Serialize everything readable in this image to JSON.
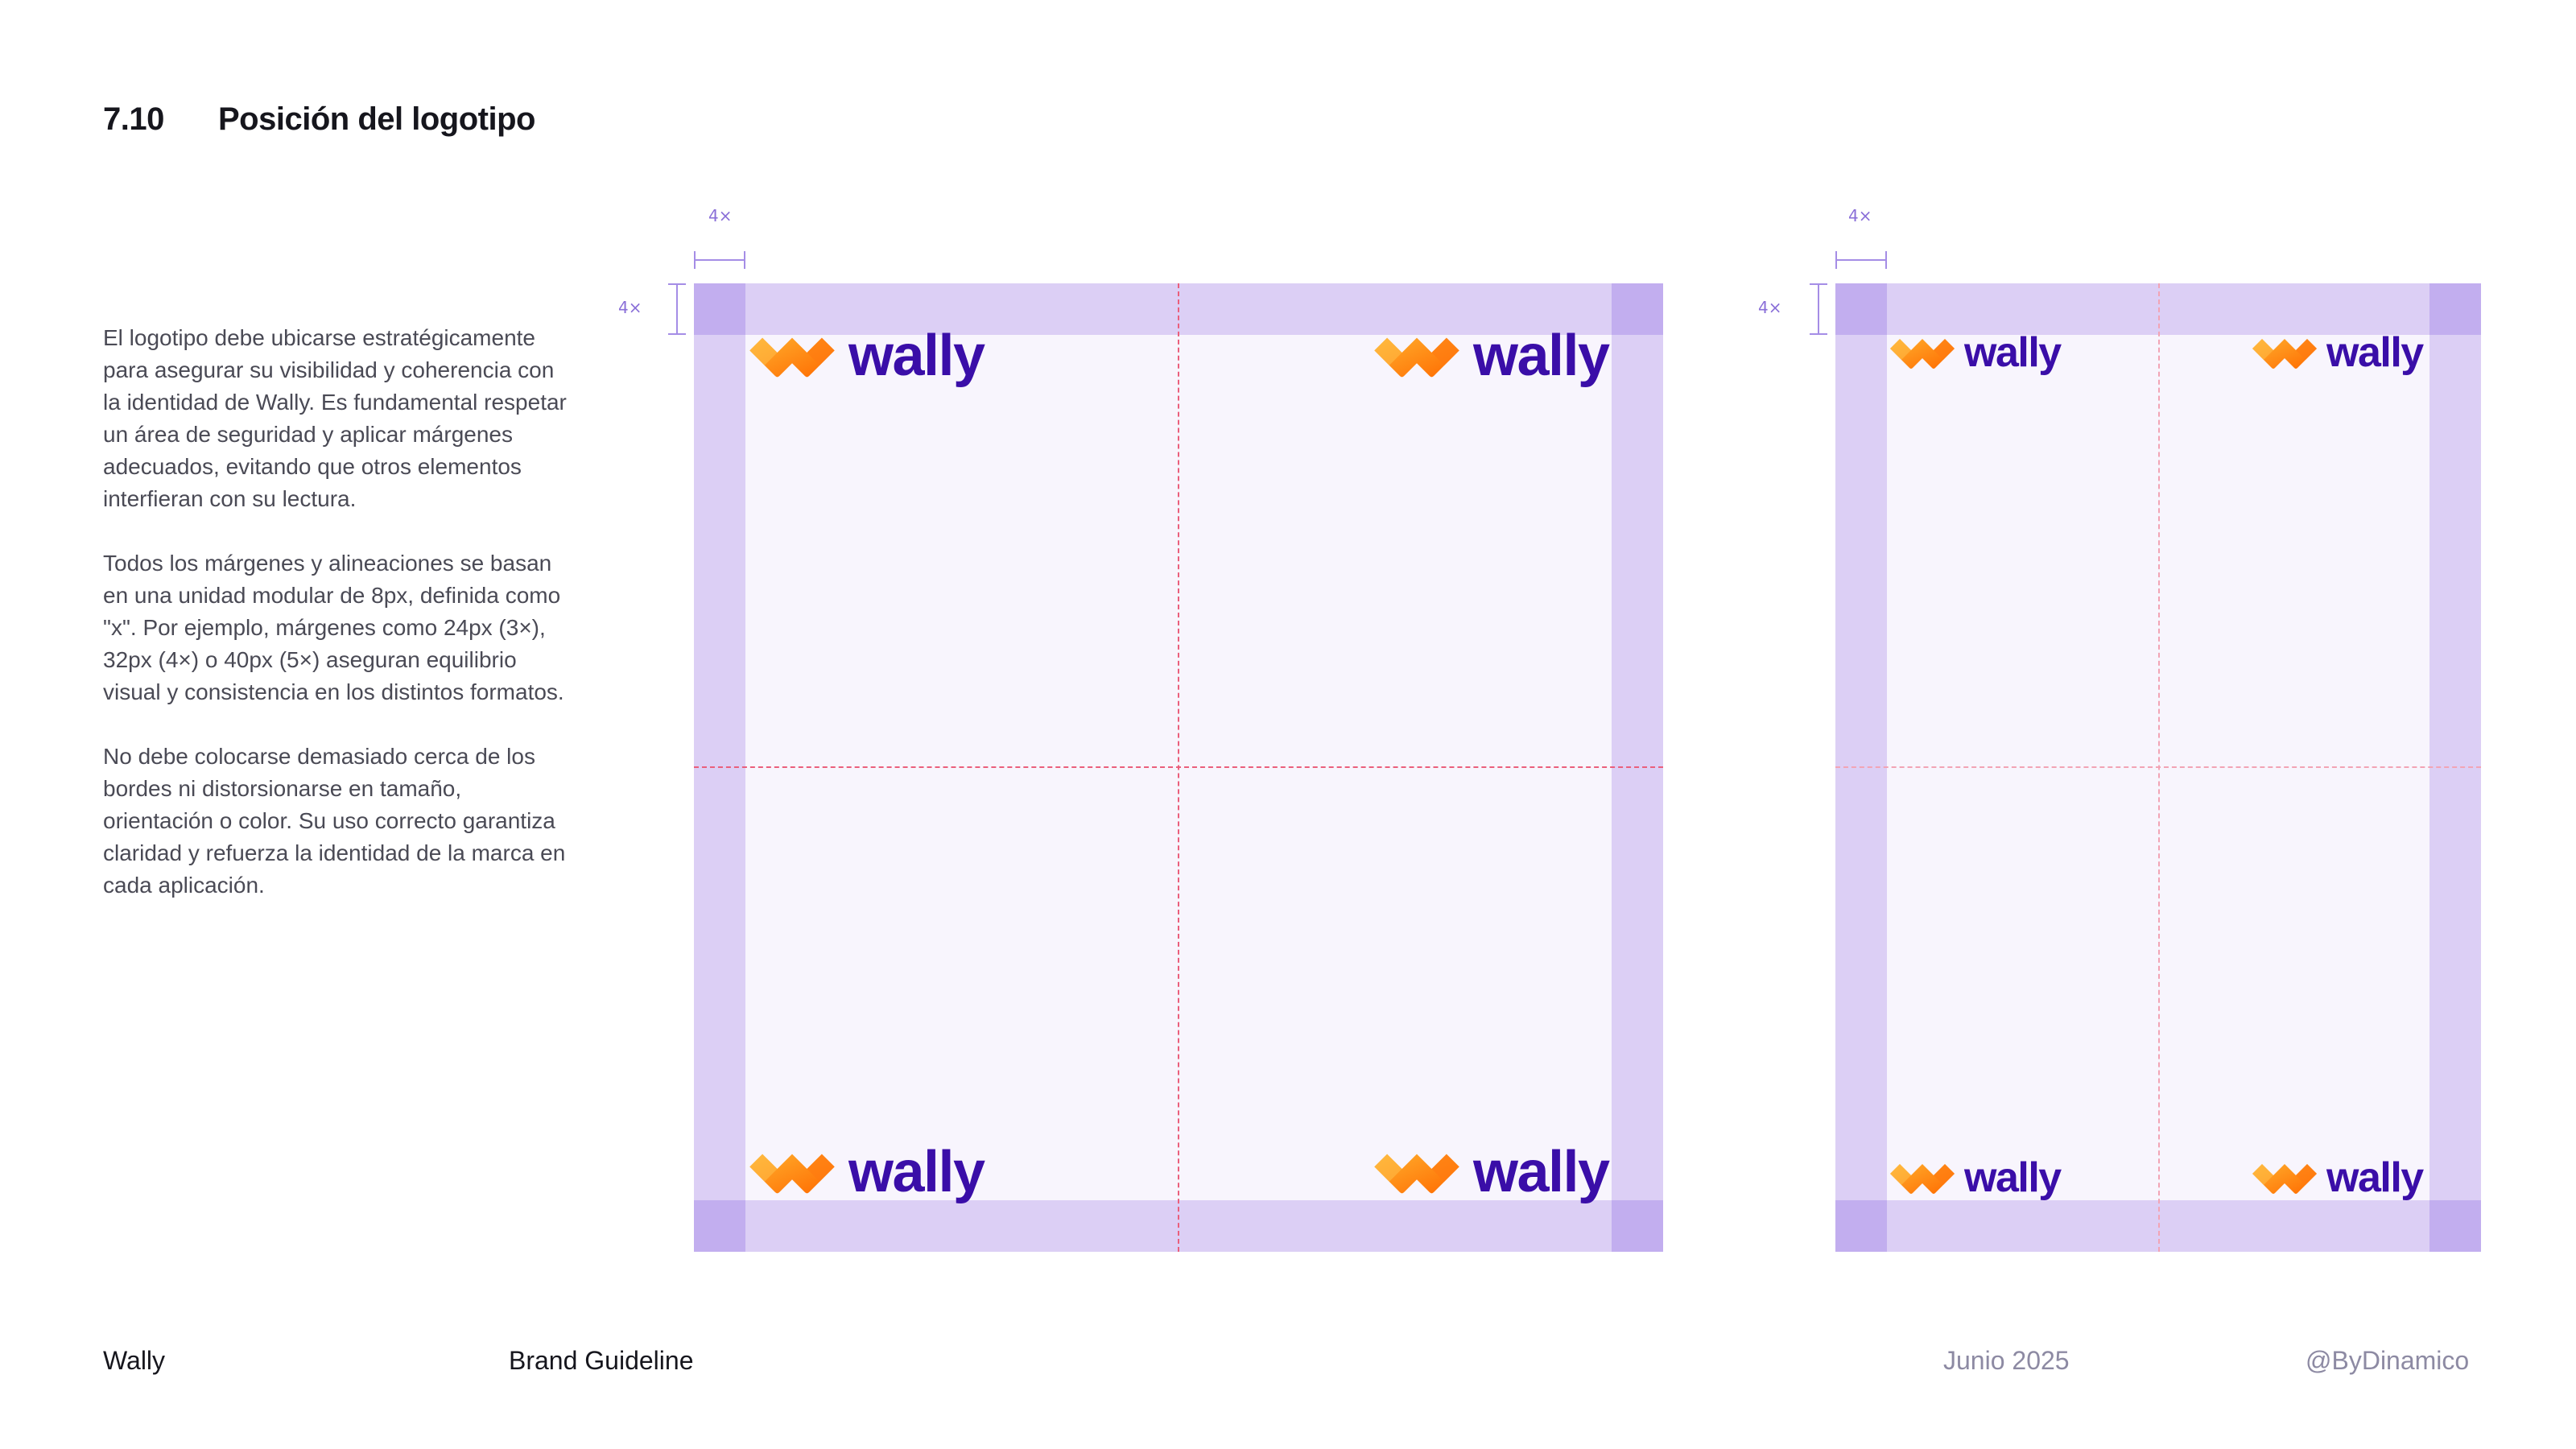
{
  "header": {
    "section_number": "7.10",
    "section_title": "Posición del logotipo"
  },
  "body": {
    "paragraphs": [
      "El logotipo debe ubicarse estratégicamente para asegurar su visibilidad y coherencia con la identidad de Wally. Es fundamental respetar un área de seguridad y aplicar márgenes adecuados, evitando que otros elementos interfieran con su lectura.",
      "Todos los márgenes y alineaciones se basan en una unidad modular de 8px, definida como \"x\". Por ejemplo, márgenes como 24px (3×), 32px (4×) o 40px (5×) aseguran equilibrio visual y consistencia en los distintos formatos.",
      "No debe colocarse demasiado cerca de los bordes ni distorsionarse en tamaño, orientación o color. Su uso correcto garantiza claridad y refuerza la identidad de la marca en cada aplicación."
    ]
  },
  "diagrams": {
    "margin_label": "4×",
    "logo_wordmark": "wally",
    "colors": {
      "margin_band": "#dccff5",
      "margin_corner": "#c2aeef",
      "canvas": "#f8f5fd",
      "guide": "#ea5f7c",
      "wordmark": "#3a0ea8",
      "symbol_orange": "#ff8a1c"
    }
  },
  "footer": {
    "brand": "Wally",
    "document": "Brand Guideline",
    "date": "Junio 2025",
    "handle": "@ByDinamico"
  }
}
